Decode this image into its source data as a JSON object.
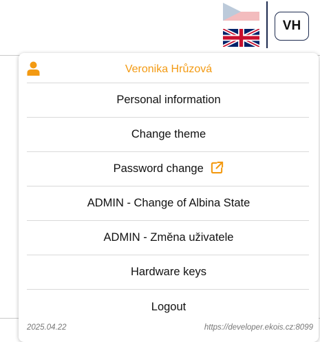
{
  "header": {
    "avatar_initials": "VH",
    "flags": [
      {
        "icon": "flag-czech-icon",
        "selected": false
      },
      {
        "icon": "flag-uk-icon",
        "selected": true
      }
    ]
  },
  "user_menu": {
    "user_name": "Veronika Hrůzová",
    "user_icon": "person-icon",
    "items": [
      {
        "label": "Personal information"
      },
      {
        "label": "Change theme"
      },
      {
        "label": "Password change",
        "icon": "external-link-icon"
      },
      {
        "label": "ADMIN - Change of Albina State"
      },
      {
        "label": "ADMIN - Změna uživatele"
      },
      {
        "label": "Hardware keys"
      },
      {
        "label": "Logout"
      }
    ],
    "footer": {
      "date": "2025.04.22",
      "url": "https://developer.ekois.cz:8099"
    }
  },
  "colors": {
    "accent_orange": "#f39a12",
    "navy": "#1d2b4f",
    "separator": "#d9d9d9"
  }
}
